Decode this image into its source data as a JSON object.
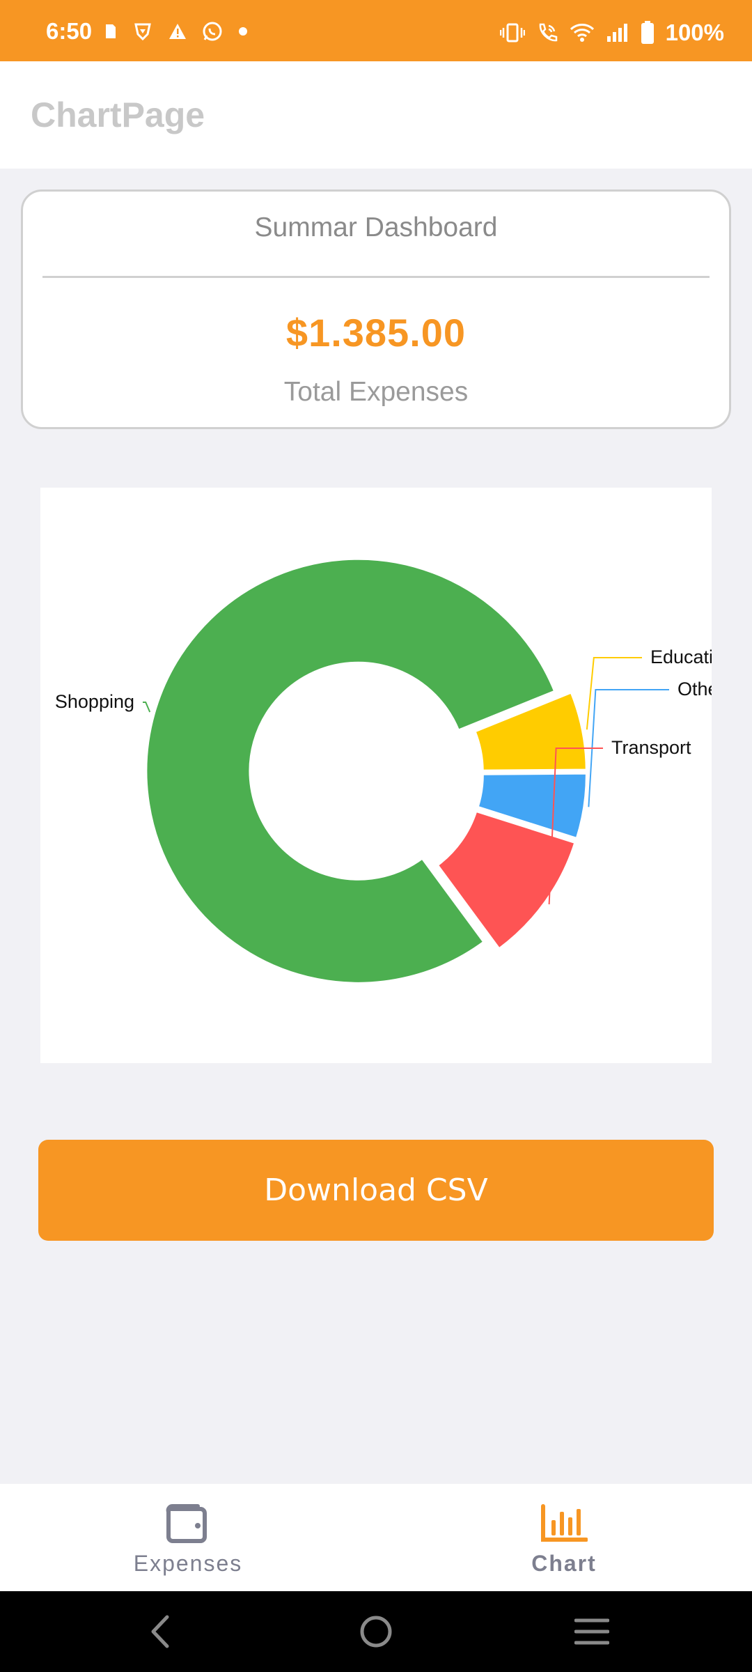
{
  "status_bar": {
    "time": "6:50",
    "battery": "100%",
    "background": "#f79623"
  },
  "app_bar": {
    "title": "ChartPage"
  },
  "summary": {
    "title": "Summar Dashboard",
    "amount": "$1.385.00",
    "amount_label": "Total Expenses",
    "accent": "#f79623"
  },
  "chart_data": {
    "type": "pie",
    "donut": true,
    "slices": [
      {
        "label": "Shopping",
        "value": 79,
        "color": "#4caf50"
      },
      {
        "label": "Transport",
        "value": 10,
        "color": "#fe5454"
      },
      {
        "label": "Others",
        "value": 5,
        "color": "#42a5f5"
      },
      {
        "label": "Education",
        "value": 6,
        "color": "#ffcc00"
      }
    ],
    "legend": "none"
  },
  "actions": {
    "download_label": "Download CSV"
  },
  "bottom_nav": {
    "items": [
      {
        "label": "Expenses",
        "icon": "wallet-icon",
        "active": false
      },
      {
        "label": "Chart",
        "icon": "bar-chart-icon",
        "active": true,
        "color": "#f79623"
      }
    ]
  },
  "system_nav": {
    "icons": [
      "back-icon",
      "home-icon",
      "recents-icon"
    ]
  }
}
